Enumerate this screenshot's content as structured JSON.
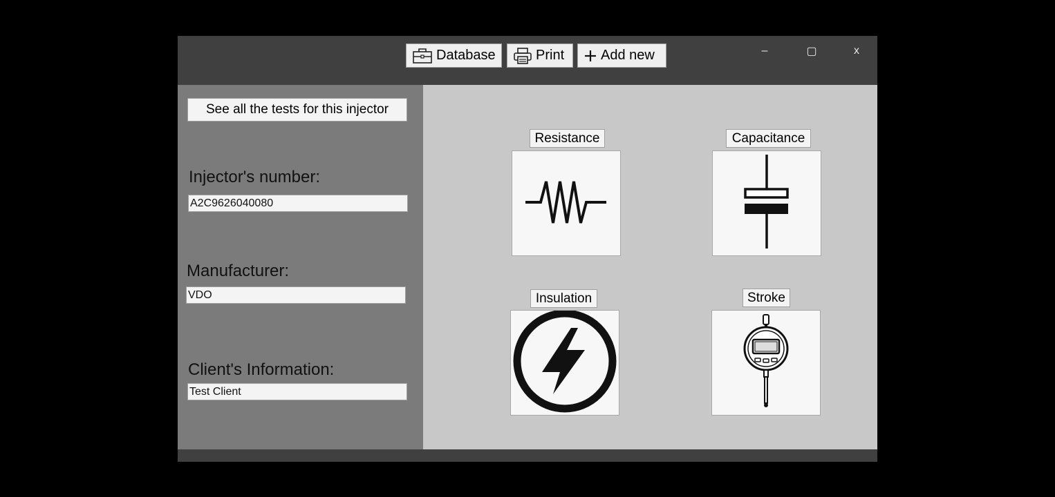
{
  "toolbar": {
    "database_label": "Database",
    "print_label": "Print",
    "add_new_label": "Add new"
  },
  "window_controls": {
    "minimize": "–",
    "maximize": "▢",
    "close": "x"
  },
  "left": {
    "see_all_label": "See all the tests for this injector",
    "injector_label": "Injector's number:",
    "injector_value": "A2C9626040080",
    "manufacturer_label": "Manufacturer:",
    "manufacturer_value": "VDO",
    "client_label": "Client's Information:",
    "client_value": "Test Client"
  },
  "tests": {
    "resistance": "Resistance",
    "capacitance": "Capacitance",
    "insulation": "Insulation",
    "stroke": "Stroke"
  },
  "icons": {
    "database": "briefcase-icon",
    "print": "printer-icon",
    "add_new": "plus-icon",
    "resistance": "resistor-icon",
    "capacitance": "capacitor-icon",
    "insulation": "lightning-bolt-icon",
    "stroke": "dial-indicator-icon"
  },
  "colors": {
    "titlebar": "#404040",
    "left_panel": "#7b7b7b",
    "right_panel": "#c8c8c8"
  }
}
